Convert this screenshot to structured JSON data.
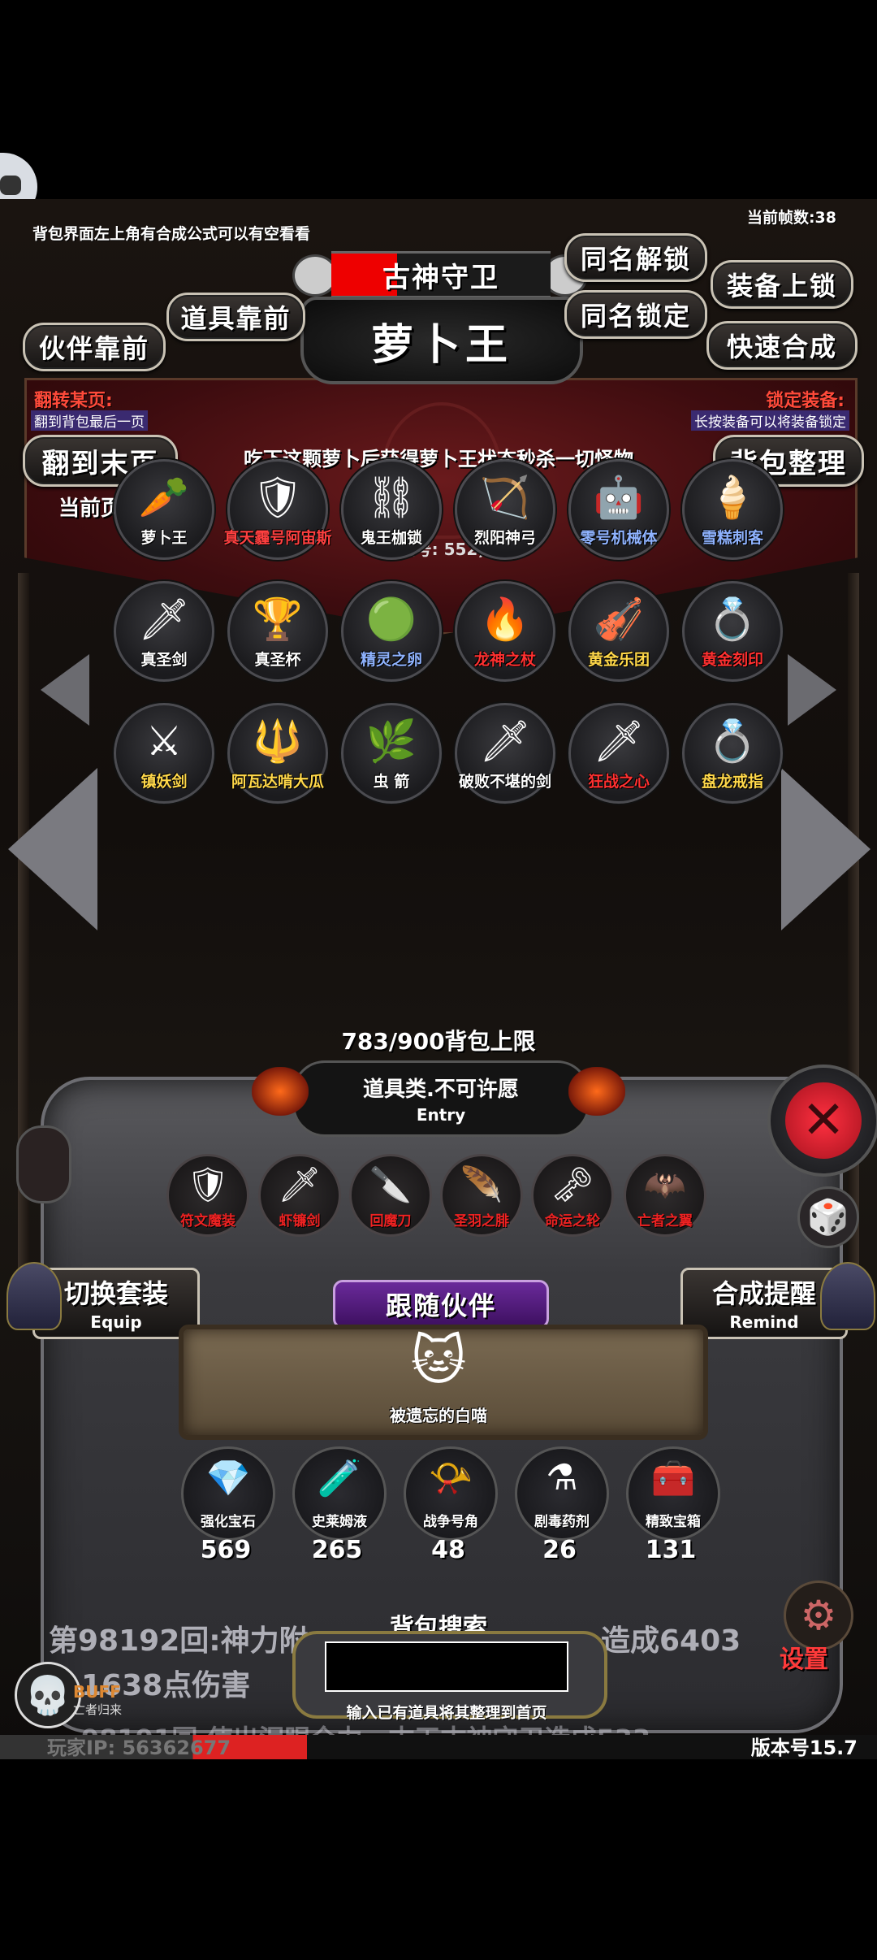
{
  "hints": {
    "top_left": "背包界面左上角有合成公式可以有空看看",
    "fps": "当前帧数:38",
    "flip_title": "翻转某页:",
    "flip_sub": "翻到背包最后一页",
    "lock_title": "锁定装备:",
    "lock_sub": "长按装备可以将装备锁定",
    "current_page": "当前页:1"
  },
  "buttons": {
    "same_unlock": "同名解锁",
    "same_lock": "同名锁定",
    "equip_lock": "装备上锁",
    "quick_craft": "快速合成",
    "items_front": "道具靠前",
    "partner_front": "伙伴靠前",
    "last_page": "翻到末页",
    "bag_sort": "背包整理",
    "switch_set": "切换套装",
    "switch_set_sub": "Equip",
    "craft_remind": "合成提醒",
    "craft_remind_sub": "Remind",
    "settings": "设置"
  },
  "item_detail": {
    "category": "古神守卫",
    "name": "萝卜王",
    "description": "吃下这颗萝卜后获得萝卜王状态秒杀一切怪物",
    "id": "(编号: 552)"
  },
  "grid": [
    {
      "label": "萝卜王",
      "icon": "🥕",
      "color": "#ffffff"
    },
    {
      "label": "真天霾号阿宙斯",
      "icon": "🛡",
      "color": "#ff4040"
    },
    {
      "label": "鬼王枷锁",
      "icon": "⛓",
      "color": "#ffffff"
    },
    {
      "label": "烈阳神弓",
      "icon": "🏹",
      "color": "#ffffff"
    },
    {
      "label": "零号机械体",
      "icon": "🤖",
      "color": "#8fb3ff"
    },
    {
      "label": "雪糕刺客",
      "icon": "🍦",
      "color": "#8fb3ff"
    },
    {
      "label": "真圣剑",
      "icon": "🗡",
      "color": "#ffffff"
    },
    {
      "label": "真圣杯",
      "icon": "🏆",
      "color": "#ffffff"
    },
    {
      "label": "精灵之卵",
      "icon": "🟢",
      "color": "#8fb3ff"
    },
    {
      "label": "龙神之杖",
      "icon": "🔥",
      "color": "#ff3030"
    },
    {
      "label": "黄金乐团",
      "icon": "🎻",
      "color": "#ffd84a"
    },
    {
      "label": "黄金刻印",
      "icon": "💍",
      "color": "#ff3030"
    },
    {
      "label": "镇妖剑",
      "icon": "⚔",
      "color": "#ffd84a"
    },
    {
      "label": "阿瓦达啃大瓜",
      "icon": "🔱",
      "color": "#ffd84a"
    },
    {
      "label": "虫 箭",
      "icon": "🌿",
      "color": "#ffffff"
    },
    {
      "label": "破败不堪的剑",
      "icon": "🗡",
      "color": "#ffffff"
    },
    {
      "label": "狂战之心",
      "icon": "🗡",
      "color": "#ff3030"
    },
    {
      "label": "盘龙戒指",
      "icon": "💍",
      "color": "#ffd84a"
    }
  ],
  "capacity": "783/900背包上限",
  "entry_title": "道具类.不可许愿",
  "entry_sub": "Entry",
  "equip_row": [
    {
      "label": "符文魔装",
      "icon": "🛡"
    },
    {
      "label": "虾镰剑",
      "icon": "🗡"
    },
    {
      "label": "回魔刀",
      "icon": "🔪"
    },
    {
      "label": "圣羽之腓",
      "icon": "🪶"
    },
    {
      "label": "命运之轮",
      "icon": "🗝"
    },
    {
      "label": "亡者之翼",
      "icon": "🦇"
    }
  ],
  "follow_partner": {
    "title": "跟随伙伴",
    "name": "被遗忘的白喵",
    "icon": "🐱"
  },
  "resources": [
    {
      "label": "强化宝石",
      "icon": "💎",
      "count": "569"
    },
    {
      "label": "史莱姆液",
      "icon": "🧪",
      "count": "265"
    },
    {
      "label": "战争号角",
      "icon": "📯",
      "count": "48"
    },
    {
      "label": "剧毒药剂",
      "icon": "⚗",
      "count": "26"
    },
    {
      "label": "精致宝箱",
      "icon": "🧰",
      "count": "131"
    }
  ],
  "log": {
    "line1": "第98192回:神力附",
    "line1b": "造成6403",
    "line2": "1638点伤害",
    "line3": "98191回 使出泪眼全力，古天古神守卫造成533"
  },
  "search": {
    "title": "背包搜索",
    "hint": "输入已有道具将其整理到首页",
    "value": ""
  },
  "footer": {
    "player_ip": "玩家IP:  56362677",
    "version": "版本号15.7",
    "buff": "BUFF",
    "buff_sub": "亡者归来"
  }
}
